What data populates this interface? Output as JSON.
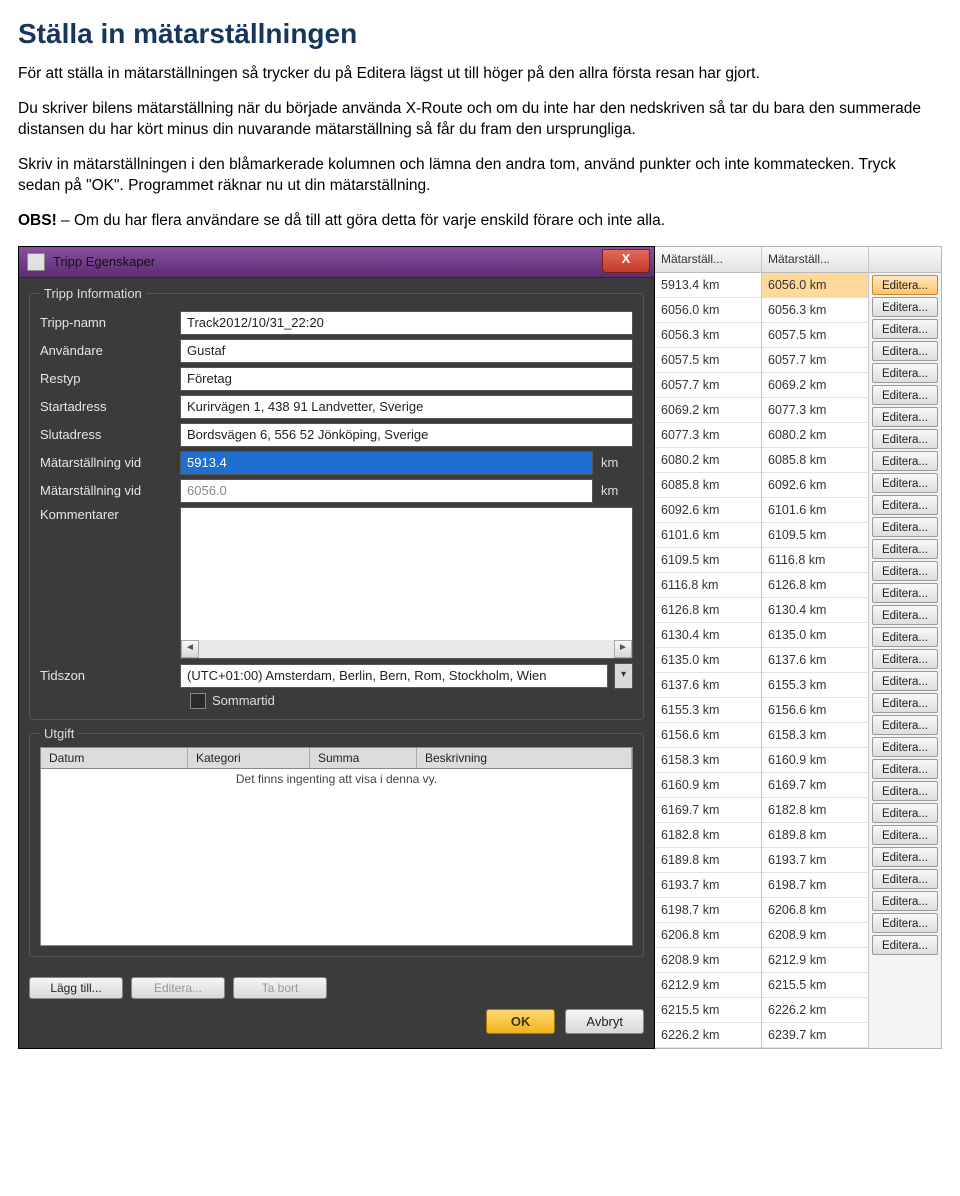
{
  "doc": {
    "title": "Ställa in mätarställningen",
    "p1": "För att ställa in mätarställningen så trycker du på Editera lägst ut till höger på den allra första resan har gjort.",
    "p2": "Du skriver bilens mätarställning när du började använda X-Route och om du inte har den nedskriven så tar du bara den summerade distansen du har kört minus din nuvarande mätarställning så får du fram den ursprungliga.",
    "p3": "Skriv in mätarställningen i den blåmarkerade kolumnen och lämna den andra tom, använd punkter och inte kommatecken. Tryck sedan på \"OK\". Programmet räknar nu ut din mätarställning.",
    "p4_bold": "OBS!",
    "p4_rest": " – Om du har flera användare se då till att göra detta för varje enskild förare och inte alla."
  },
  "dialog": {
    "title": "Tripp Egenskaper",
    "close": "X",
    "legend_info": "Tripp Information",
    "labels": {
      "tripname": "Tripp-namn",
      "user": "Användare",
      "type": "Restyp",
      "start": "Startadress",
      "end": "Slutadress",
      "odo1": "Mätarställning vid",
      "odo2": "Mätarställning vid",
      "comment": "Kommentarer",
      "tz": "Tidszon",
      "dst": "Sommartid"
    },
    "values": {
      "tripname": "Track2012/10/31_22:20",
      "user": "Gustaf",
      "type": "Företag",
      "start": "Kurirvägen 1, 438 91 Landvetter, Sverige",
      "end": "Bordsvägen 6, 556 52 Jönköping, Sverige",
      "odo1": "5913.4",
      "odo2": "6056.0",
      "unit": "km",
      "tz": "(UTC+01:00) Amsterdam, Berlin, Bern, Rom, Stockholm, Wien"
    },
    "legend_utgift": "Utgift",
    "utgift_headers": {
      "d": "Datum",
      "k": "Kategori",
      "s": "Summa",
      "b": "Beskrivning"
    },
    "utgift_empty": "Det finns ingenting att visa i denna vy.",
    "buttons": {
      "add": "Lägg till...",
      "edit": "Editera...",
      "del": "Ta bort",
      "ok": "OK",
      "cancel": "Avbryt"
    }
  },
  "grid": {
    "h1": "Mätarställ...",
    "h2": "Mätarställ...",
    "h3": "",
    "edit_label": "Editera...",
    "rows": [
      {
        "a": "5913.4 km",
        "b": "6056.0 km",
        "hl": true
      },
      {
        "a": "6056.0 km",
        "b": "6056.3 km"
      },
      {
        "a": "6056.3 km",
        "b": "6057.5 km"
      },
      {
        "a": "6057.5 km",
        "b": "6057.7 km"
      },
      {
        "a": "6057.7 km",
        "b": "6069.2 km"
      },
      {
        "a": "6069.2 km",
        "b": "6077.3 km"
      },
      {
        "a": "6077.3 km",
        "b": "6080.2 km"
      },
      {
        "a": "6080.2 km",
        "b": "6085.8 km"
      },
      {
        "a": "6085.8 km",
        "b": "6092.6 km"
      },
      {
        "a": "6092.6 km",
        "b": "6101.6 km"
      },
      {
        "a": "6101.6 km",
        "b": "6109.5 km"
      },
      {
        "a": "6109.5 km",
        "b": "6116.8 km"
      },
      {
        "a": "6116.8 km",
        "b": "6126.8 km"
      },
      {
        "a": "6126.8 km",
        "b": "6130.4 km"
      },
      {
        "a": "6130.4 km",
        "b": "6135.0 km"
      },
      {
        "a": "6135.0 km",
        "b": "6137.6 km"
      },
      {
        "a": "6137.6 km",
        "b": "6155.3 km"
      },
      {
        "a": "6155.3 km",
        "b": "6156.6 km"
      },
      {
        "a": "6156.6 km",
        "b": "6158.3 km"
      },
      {
        "a": "6158.3 km",
        "b": "6160.9 km"
      },
      {
        "a": "6160.9 km",
        "b": "6169.7 km"
      },
      {
        "a": "6169.7 km",
        "b": "6182.8 km"
      },
      {
        "a": "6182.8 km",
        "b": "6189.8 km"
      },
      {
        "a": "6189.8 km",
        "b": "6193.7 km"
      },
      {
        "a": "6193.7 km",
        "b": "6198.7 km"
      },
      {
        "a": "6198.7 km",
        "b": "6206.8 km"
      },
      {
        "a": "6206.8 km",
        "b": "6208.9 km"
      },
      {
        "a": "6208.9 km",
        "b": "6212.9 km"
      },
      {
        "a": "6212.9 km",
        "b": "6215.5 km"
      },
      {
        "a": "6215.5 km",
        "b": "6226.2 km"
      },
      {
        "a": "6226.2 km",
        "b": "6239.7 km"
      }
    ]
  }
}
